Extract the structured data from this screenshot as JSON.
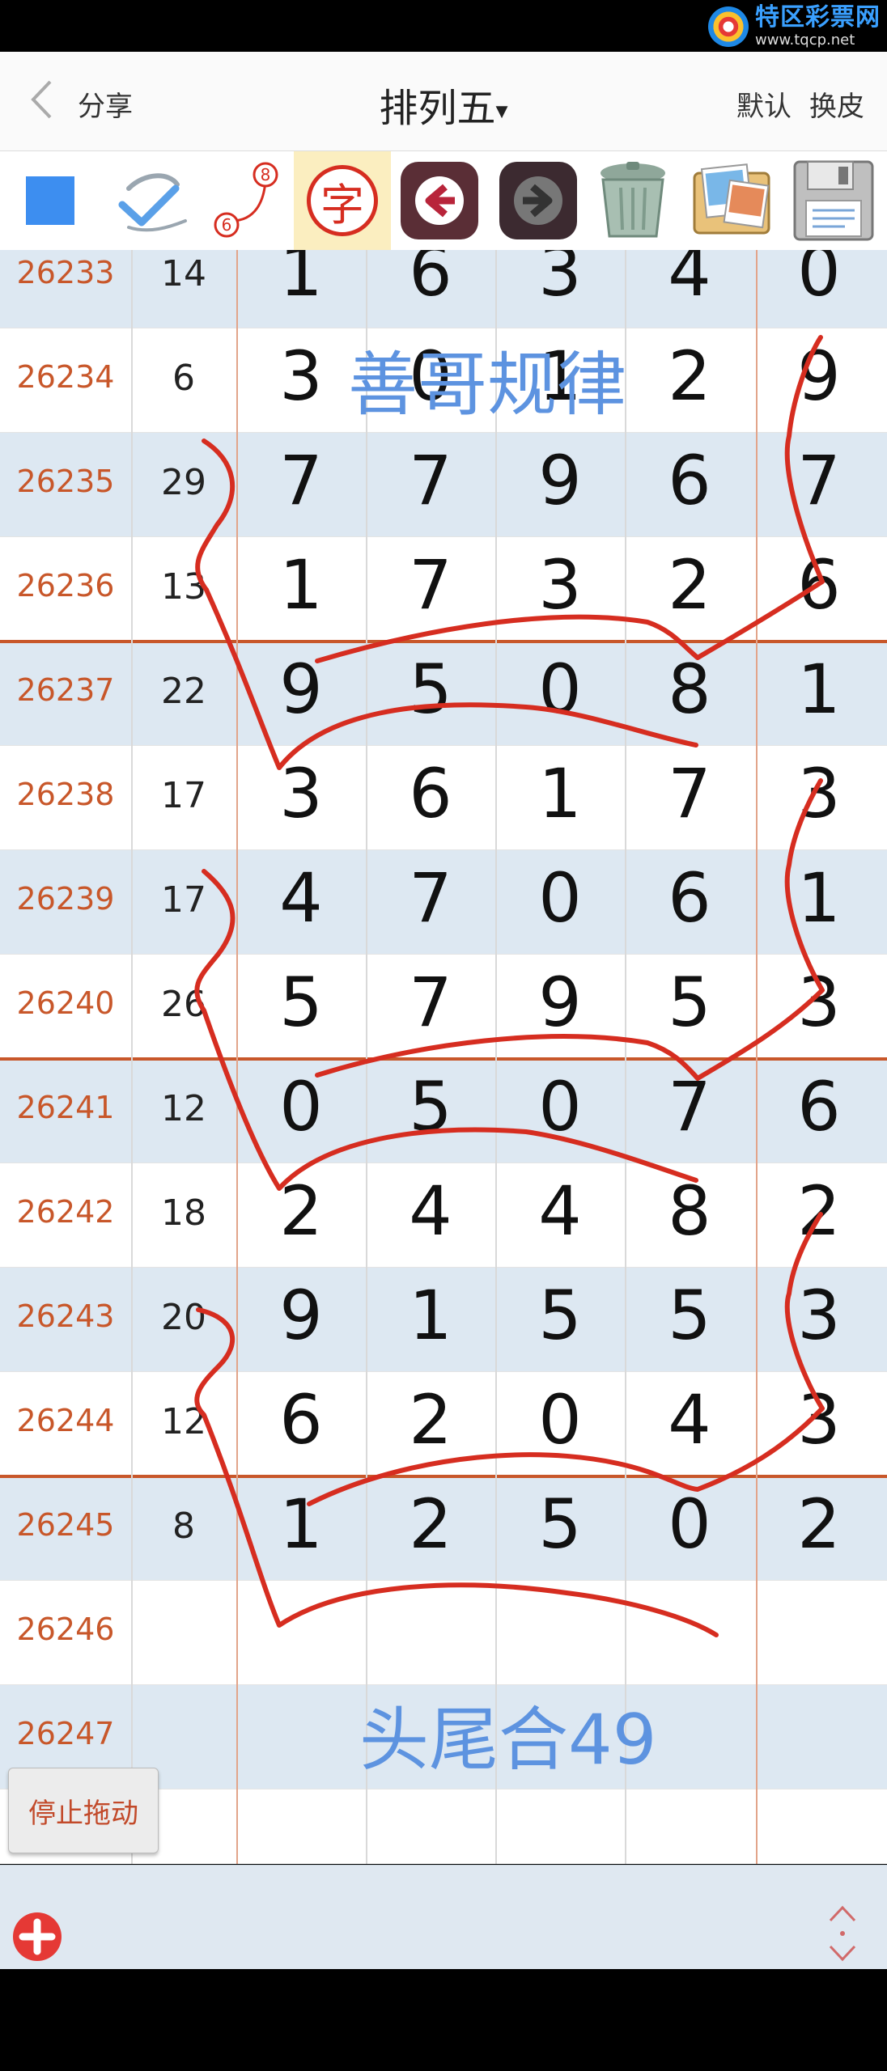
{
  "watermark": {
    "title": "特区彩票网",
    "url": "www.tqcp.net"
  },
  "header": {
    "share_label": "分享",
    "title": "排列五",
    "title_caret": "▾",
    "default_label": "默认",
    "skin_label": "换皮"
  },
  "toolbar": {
    "char_label": "字",
    "num_a": "8",
    "num_b": "6"
  },
  "colors": {
    "accent_blue": "#3d8ef0",
    "red_line": "#d62d20",
    "id_orange": "#c8572a",
    "stripe": "#dde8f2"
  },
  "rows": [
    {
      "id": "26233",
      "sum": "14",
      "digits": [
        "1",
        "6",
        "3",
        "4",
        "0"
      ]
    },
    {
      "id": "26234",
      "sum": "6",
      "digits": [
        "3",
        "0",
        "1",
        "2",
        "9"
      ]
    },
    {
      "id": "26235",
      "sum": "29",
      "digits": [
        "7",
        "7",
        "9",
        "6",
        "7"
      ]
    },
    {
      "id": "26236",
      "sum": "13",
      "digits": [
        "1",
        "7",
        "3",
        "2",
        "6"
      ]
    },
    {
      "id": "26237",
      "sum": "22",
      "digits": [
        "9",
        "5",
        "0",
        "8",
        "1"
      ]
    },
    {
      "id": "26238",
      "sum": "17",
      "digits": [
        "3",
        "6",
        "1",
        "7",
        "3"
      ]
    },
    {
      "id": "26239",
      "sum": "17",
      "digits": [
        "4",
        "7",
        "0",
        "6",
        "1"
      ]
    },
    {
      "id": "26240",
      "sum": "26",
      "digits": [
        "5",
        "7",
        "9",
        "5",
        "3"
      ]
    },
    {
      "id": "26241",
      "sum": "12",
      "digits": [
        "0",
        "5",
        "0",
        "7",
        "6"
      ]
    },
    {
      "id": "26242",
      "sum": "18",
      "digits": [
        "2",
        "4",
        "4",
        "8",
        "2"
      ]
    },
    {
      "id": "26243",
      "sum": "20",
      "digits": [
        "9",
        "1",
        "5",
        "5",
        "3"
      ]
    },
    {
      "id": "26244",
      "sum": "12",
      "digits": [
        "6",
        "2",
        "0",
        "4",
        "3"
      ]
    },
    {
      "id": "26245",
      "sum": "8",
      "digits": [
        "1",
        "2",
        "5",
        "0",
        "2"
      ]
    },
    {
      "id": "26246",
      "sum": "",
      "digits": [
        "",
        "",
        "",
        "",
        ""
      ]
    },
    {
      "id": "26247",
      "sum": "",
      "digits": [
        "",
        "",
        "",
        "",
        ""
      ]
    },
    {
      "id": "",
      "sum": "",
      "digits": [
        "",
        "",
        "",
        "",
        ""
      ]
    }
  ],
  "overlay": {
    "rule_text": "善哥规律",
    "tail_text": "头尾合49"
  },
  "drag_button": "停止拖动"
}
